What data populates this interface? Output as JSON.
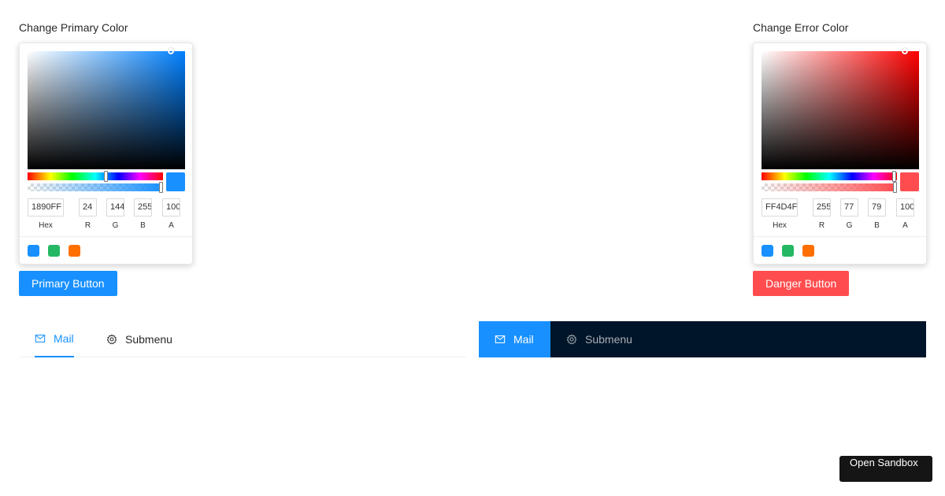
{
  "primary_picker": {
    "title": "Change Primary Color",
    "hue_color": "#0080ff",
    "swatch_color": "#1890ff",
    "hue_fraction": 0.583,
    "alpha_fraction": 1.0,
    "hex": "1890FF",
    "r": "24",
    "g": "144",
    "b": "255",
    "a": "100",
    "labels": {
      "hex": "Hex",
      "r": "R",
      "g": "G",
      "b": "B",
      "a": "A"
    },
    "presets": [
      "#1890ff",
      "#25b864",
      "#ff6f00"
    ]
  },
  "error_picker": {
    "title": "Change Error Color",
    "hue_color": "#ff0000",
    "swatch_color": "#ff4d4f",
    "hue_fraction": 0.995,
    "alpha_fraction": 1.0,
    "hex": "FF4D4F",
    "r": "255",
    "g": "77",
    "b": "79",
    "a": "100",
    "labels": {
      "hex": "Hex",
      "r": "R",
      "g": "G",
      "b": "B",
      "a": "A"
    },
    "presets": [
      "#1890ff",
      "#25b864",
      "#ff6f00"
    ]
  },
  "buttons": {
    "primary_label": "Primary Button",
    "primary_color": "#1890ff",
    "danger_label": "Danger Button",
    "danger_color": "#ff4d4f"
  },
  "menu_light": {
    "items": [
      {
        "label": "Mail",
        "icon": "mail-icon",
        "active": true
      },
      {
        "label": "Submenu",
        "icon": "setting-icon",
        "active": false
      }
    ]
  },
  "menu_dark": {
    "items": [
      {
        "label": "Mail",
        "icon": "mail-icon",
        "active": true
      },
      {
        "label": "Submenu",
        "icon": "setting-icon",
        "active": false
      }
    ]
  },
  "sandbox": {
    "label": "Open Sandbox"
  }
}
